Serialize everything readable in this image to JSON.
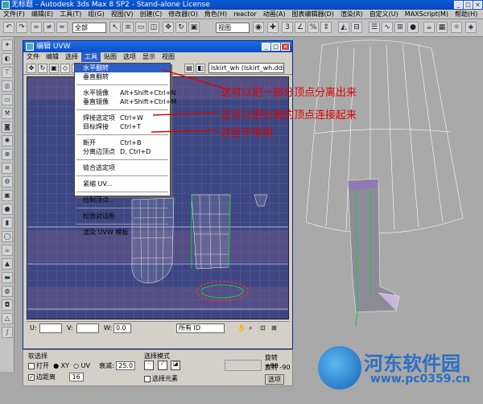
{
  "app": {
    "title": "无标题 - Autodesk 3ds Max 8 SP2 - Stand-alone License",
    "menu": [
      "文件(F)",
      "编辑(E)",
      "工具(T)",
      "组(G)",
      "视图(V)",
      "创建(C)",
      "修改器(O)",
      "角色(H)",
      "reactor",
      "动画(A)",
      "图表编辑器(D)",
      "渲染(R)",
      "自定义(U)",
      "MAXScript(M)",
      "帮助(H)"
    ],
    "toolbar_select_all": "全部",
    "toolbar_view": "视图"
  },
  "uvw": {
    "title": "编辑 UVW",
    "menu": [
      "文件",
      "编辑",
      "选择",
      "工具",
      "贴图",
      "选项",
      "显示",
      "视图"
    ],
    "active_menu_index": 3,
    "texture_select": "lskirt_wh (lskirt_wh.dds)",
    "u_label": "U:",
    "v_label": "V:",
    "w_label": "W:",
    "w_value": "0.0",
    "all_id": "所有 ID"
  },
  "dropdown": {
    "items": [
      {
        "label": "水平翻转",
        "shortcut": "",
        "highlight": true
      },
      {
        "label": "垂直翻转",
        "shortcut": ""
      },
      {
        "sep": true
      },
      {
        "label": "水平镜像",
        "shortcut": "Alt+Shift+Ctrl+N"
      },
      {
        "label": "垂直镜像",
        "shortcut": "Alt+Shift+Ctrl+M"
      },
      {
        "sep": true
      },
      {
        "label": "焊接选定项",
        "shortcut": "Ctrl+W"
      },
      {
        "label": "目标焊接",
        "shortcut": "Ctrl+T"
      },
      {
        "sep": true
      },
      {
        "label": "断开",
        "shortcut": "Ctrl+B"
      },
      {
        "label": "分离边顶点",
        "shortcut": "D, Ctrl+D"
      },
      {
        "sep": true
      },
      {
        "label": "链合选定项",
        "shortcut": ""
      },
      {
        "sep": true
      },
      {
        "label": "紧缩 UV...",
        "shortcut": ""
      },
      {
        "sep": true
      },
      {
        "label": "绘制顶点...",
        "shortcut": ""
      },
      {
        "sep": true
      },
      {
        "label": "松弛对话框",
        "shortcut": ""
      },
      {
        "sep": true
      },
      {
        "label": "渲染 UVW 模板",
        "shortcut": ""
      }
    ]
  },
  "annotations": {
    "a1": "这可以把一部分顶点分离出来",
    "a2": "这可以把分离的顶点连接起来",
    "a3": "这些不常用"
  },
  "bottom_panel": {
    "soft_select_title": "软选择",
    "open_label": "打开",
    "xy_label": "XY",
    "uv_label": "UV",
    "falloff_label": "衰减:",
    "falloff_value": "25.0",
    "edge_distance_label": "边距离",
    "edge_distance_value": "16",
    "select_mode_title": "选择模式",
    "select_element_label": "选择元素",
    "rotate_label": "旋转",
    "rotate_plus": "+90",
    "rotate_minus": "-90",
    "options_label": "选项"
  },
  "watermark": {
    "name": "河东软件园",
    "url": "www.pc0359.cn"
  },
  "colors": {
    "title_blue": "#0b4fc6",
    "uv_bg": "#3d4680",
    "grid": "#6a74c0",
    "annotation": "#e00000",
    "wireframe": "#ffffff",
    "seam_green": "#22c84a"
  }
}
